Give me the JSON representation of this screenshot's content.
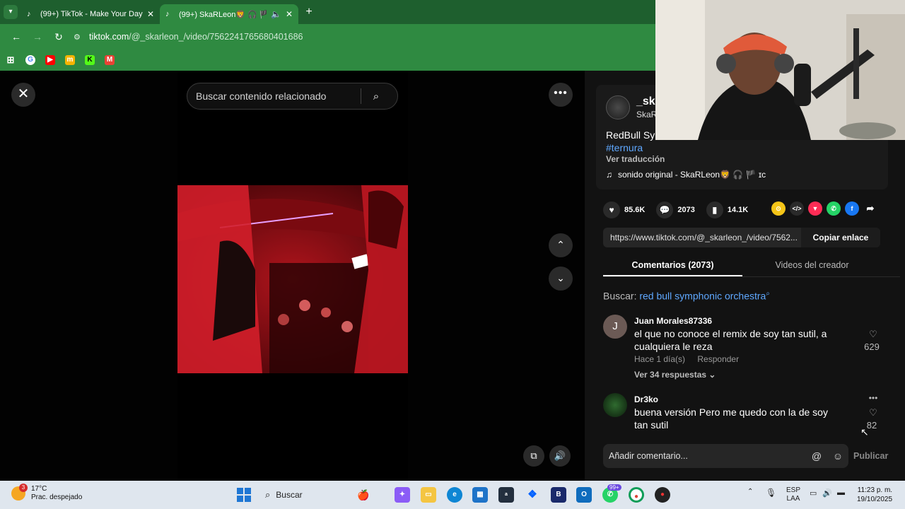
{
  "browser": {
    "tabs": [
      {
        "title": "(99+) TikTok - Make Your Day"
      },
      {
        "title": "(99+) SkaRLeon🦁 🎧 🏴 ɪc"
      }
    ],
    "url_host": "tiktok.com",
    "url_path": "/@_skarleon_/video/7562241765680401686"
  },
  "search": {
    "placeholder": "Buscar contenido relacionado"
  },
  "video": {
    "author": "_ska",
    "nick": "SkaR",
    "desc": "RedBull Sym",
    "hashtag": "#ternura",
    "translate": "Ver traducción",
    "sound": "sonido original - SkaRLeon🦁 🎧 🏴 ɪc"
  },
  "stats": {
    "likes": "85.6K",
    "comments": "2073",
    "saves": "14.1K"
  },
  "share": {
    "url": "https://www.tiktok.com/@_skarleon_/video/7562...",
    "copy_label": "Copiar enlace"
  },
  "tabs2": {
    "comments": "Comentarios (2073)",
    "creator": "Videos del creador"
  },
  "buscar": {
    "label": "Buscar:",
    "query": "red bull symphonic orchestra"
  },
  "comments": [
    {
      "initial": "J",
      "user": "Juan Morales87336",
      "text": "el que no conoce el remix de soy tan sutil, a cualquiera le reza",
      "time": "Hace 1 día(s)",
      "reply": "Responder",
      "replies": "Ver 34 respuestas",
      "likes": "629"
    },
    {
      "user": "Dr3ko",
      "text": "buena versión Pero me quedo con la de soy tan sutil",
      "likes": "82"
    }
  ],
  "composer": {
    "placeholder": "Añadir comentario...",
    "publish": "Publicar"
  },
  "taskbar": {
    "temp": "17°C",
    "weather": "Prac. despejado",
    "search": "Buscar",
    "lang1": "ESP",
    "lang2": "LAA",
    "time": "11:23 p. m.",
    "date": "19/10/2025",
    "badge": "99+",
    "weather_badge": "3"
  }
}
